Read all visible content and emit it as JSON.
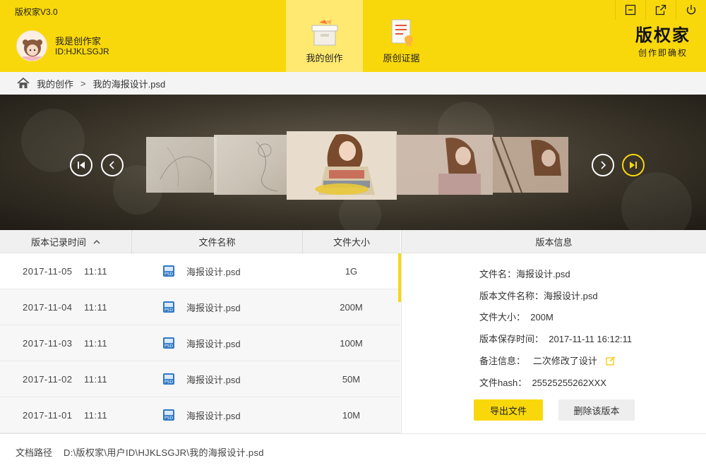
{
  "app": {
    "title": "版权家V3.0"
  },
  "user": {
    "name": "我是创作家",
    "id": "ID:HJKLSGJR"
  },
  "nav": {
    "tabs": [
      {
        "label": "我的创作",
        "icon": "box-icon",
        "active": true
      },
      {
        "label": "原创证据",
        "icon": "certificate-icon",
        "active": false
      }
    ]
  },
  "brand": {
    "name": "版权家",
    "slogan": "创作即确权"
  },
  "window_controls": [
    "minimize-icon",
    "external-link-icon",
    "power-icon"
  ],
  "breadcrumb": {
    "items": [
      "我的创作",
      "我的海报设计.psd"
    ],
    "separator": ">"
  },
  "table": {
    "headers": {
      "time": "版本记录时间",
      "name": "文件名称",
      "size": "文件大小"
    },
    "rows": [
      {
        "date": "2017-11-05",
        "time": "11:11",
        "name": "海报设计.psd",
        "size": "1G"
      },
      {
        "date": "2017-11-04",
        "time": "11:11",
        "name": "海报设计.psd",
        "size": "200M"
      },
      {
        "date": "2017-11-03",
        "time": "11:11",
        "name": "海报设计.psd",
        "size": "100M"
      },
      {
        "date": "2017-11-02",
        "time": "11:11",
        "name": "海报设计.psd",
        "size": "50M"
      },
      {
        "date": "2017-11-01",
        "time": "11:11",
        "name": "海报设计.psd",
        "size": "10M"
      }
    ]
  },
  "info": {
    "header": "版本信息",
    "filename": "文件名：海报设计.psd",
    "version_name": "版本文件名称：海报设计.psd",
    "size_label": "文件大小：",
    "size_value": "200M",
    "saved_label": "版本保存时间：",
    "saved_value": "2017-11-11  16:12:11",
    "note_label": "备注信息：",
    "note_value": "二次修改了设计",
    "hash_label": "文件hash：",
    "hash_value": "25525255262XXX",
    "export_label": "导出文件",
    "delete_label": "删除该版本"
  },
  "footer": {
    "label": "文档路径",
    "path": "D:\\版权家\\用户ID\\HJKLSGJR\\我的海报设计.psd"
  },
  "colors": {
    "accent": "#f9d80b",
    "tab_active": "#ffe970"
  }
}
